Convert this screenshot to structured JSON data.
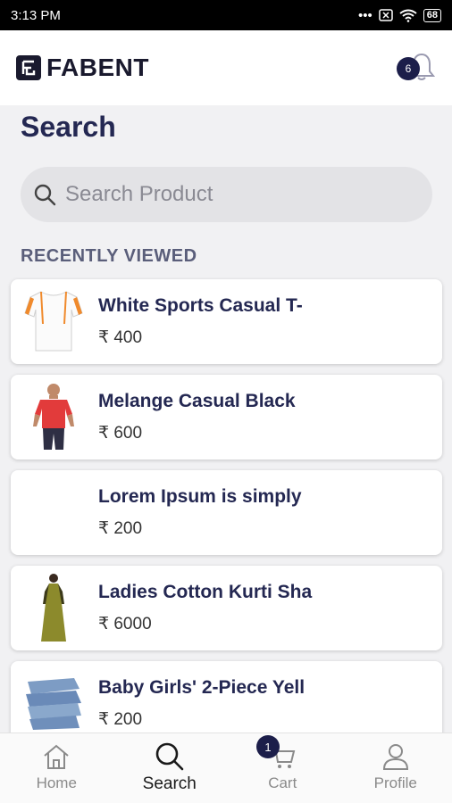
{
  "status_bar": {
    "time": "3:13 PM",
    "battery": "68"
  },
  "header": {
    "logo_text": "FABENT",
    "notification_count": "6"
  },
  "page": {
    "title": "Search"
  },
  "search": {
    "placeholder": "Search Product",
    "value": ""
  },
  "recently_viewed": {
    "title": "RECENTLY VIEWED",
    "items": [
      {
        "name": "White Sports Casual T-",
        "price": "₹ 400",
        "image": "white-tshirt"
      },
      {
        "name": "Melange Casual Black",
        "price": "₹ 600",
        "image": "red-tshirt-man"
      },
      {
        "name": "Lorem Ipsum is simply",
        "price": "₹ 200",
        "image": ""
      },
      {
        "name": "Ladies Cotton Kurti Sha",
        "price": "₹ 6000",
        "image": "olive-kurti"
      },
      {
        "name": "Baby Girls' 2-Piece Yell",
        "price": "₹ 200",
        "image": "denim-stack"
      }
    ]
  },
  "bottom_nav": {
    "home": "Home",
    "search": "Search",
    "cart": "Cart",
    "cart_count": "1",
    "profile": "Profile"
  },
  "colors": {
    "primary": "#242852",
    "badge": "#1c1e4a",
    "background": "#f1f1f3"
  }
}
